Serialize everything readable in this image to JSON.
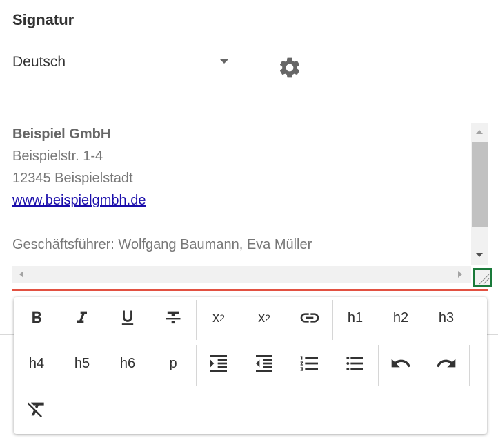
{
  "section": {
    "title": "Signatur"
  },
  "language_select": {
    "value": "Deutsch"
  },
  "signature": {
    "company": "Beispiel GmbH",
    "street": "Beispielstr. 1-4",
    "city": "12345 Beispielstadt",
    "website": "www.beispielgmbh.de",
    "managers": "Geschäftsführer: Wolfgang Baumann, Eva Müller"
  },
  "toolbar": {
    "subscript": "x",
    "subscript_sub": "2",
    "superscript": "x",
    "superscript_sup": "2",
    "h1": "h1",
    "h2": "h2",
    "h3": "h3",
    "h4": "h4",
    "h5": "h5",
    "h6": "h6",
    "p": "p"
  },
  "colors": {
    "accent_line": "#e25141",
    "resize_handle_border": "#1a7a3a",
    "link": "#1a0dab"
  },
  "icons": [
    "chevron-down-icon",
    "gear-icon",
    "bold-icon",
    "italic-icon",
    "underline-icon",
    "strikethrough-icon",
    "link-icon",
    "indent-icon",
    "outdent-icon",
    "ordered-list-icon",
    "unordered-list-icon",
    "undo-icon",
    "redo-icon",
    "clear-format-icon"
  ]
}
